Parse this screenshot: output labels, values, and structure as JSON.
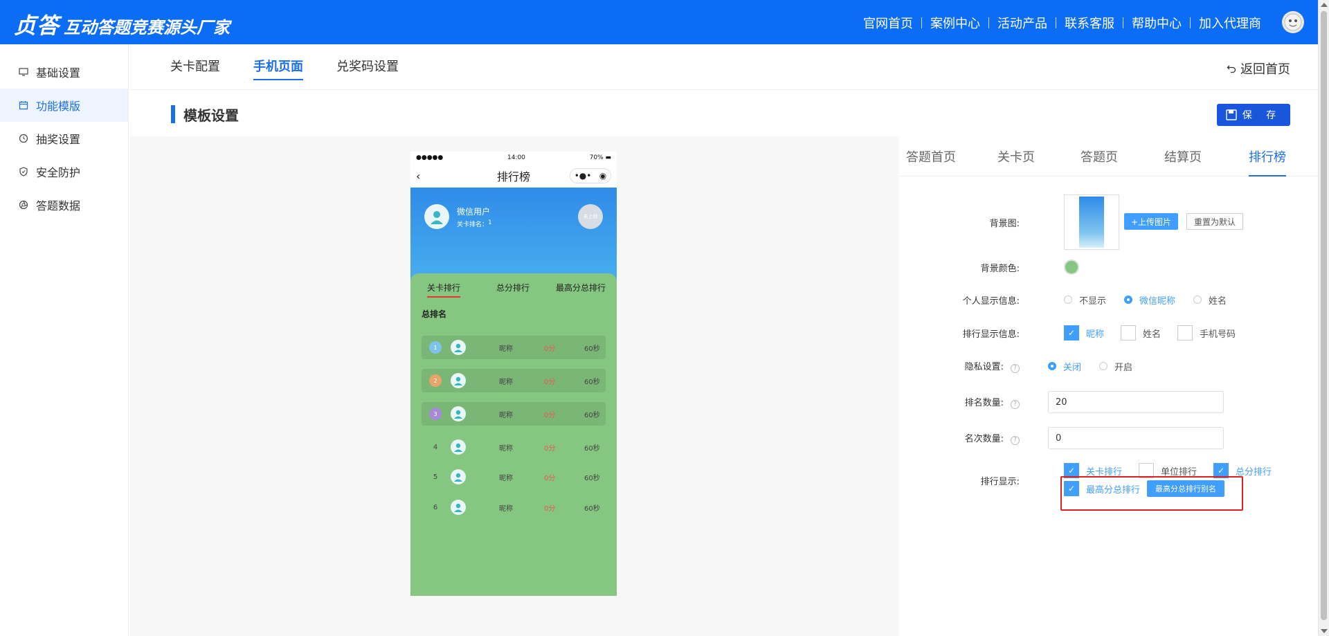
{
  "brand": {
    "logo": "贞答",
    "tagline": "互动答题竞赛源头厂家"
  },
  "topnav": [
    "官网首页",
    "案例中心",
    "活动产品",
    "联系客服",
    "帮助中心",
    "加入代理商"
  ],
  "sidebar": {
    "items": [
      {
        "label": "基础设置",
        "icon": "monitor-icon"
      },
      {
        "label": "功能模版",
        "icon": "calendar-icon",
        "active": true
      },
      {
        "label": "抽奖设置",
        "icon": "clock-icon"
      },
      {
        "label": "安全防护",
        "icon": "shield-icon"
      },
      {
        "label": "答题数据",
        "icon": "aperture-icon"
      }
    ]
  },
  "subtabs": [
    {
      "label": "关卡配置"
    },
    {
      "label": "手机页面",
      "active": true
    },
    {
      "label": "兑奖码设置"
    }
  ],
  "back_home": "返回首页",
  "section_title": "模板设置",
  "save_label": "保 存",
  "phone": {
    "status_signal": "●●●●●",
    "status_time": "14:00",
    "status_battery": "70%",
    "nav_title": "排行榜",
    "capsule_more": "•●•",
    "user_name": "微信用户",
    "user_rank_label": "关卡排名：",
    "user_rank_value": "1",
    "badge_text": "未上榜",
    "rank_tabs": [
      "关卡排行",
      "总分排行",
      "最高分总排行"
    ],
    "total_label": "总排名",
    "rows": [
      {
        "num": "1",
        "nick": "昵称",
        "score": "0分",
        "time": "60秒"
      },
      {
        "num": "2",
        "nick": "昵称",
        "score": "0分",
        "time": "60秒"
      },
      {
        "num": "3",
        "nick": "昵称",
        "score": "0分",
        "time": "60秒"
      },
      {
        "num": "4",
        "nick": "昵称",
        "score": "0分",
        "time": "60秒"
      },
      {
        "num": "5",
        "nick": "昵称",
        "score": "0分",
        "time": "60秒"
      },
      {
        "num": "6",
        "nick": "昵称",
        "score": "0分",
        "time": "60秒"
      }
    ],
    "colors": {
      "hero_top": "#2f8be8",
      "panel_green": "#85c680"
    }
  },
  "settings": {
    "tabs": [
      "答题首页",
      "关卡页",
      "答题页",
      "结算页",
      "排行榜"
    ],
    "active_tab": "排行榜",
    "bg_image_label": "背景图:",
    "upload_label": "+上传图片",
    "reset_label": "重置为默认",
    "bg_color_label": "背景颜色:",
    "bg_color": "#85c680",
    "personal_label": "个人显示信息:",
    "personal_options": [
      "不显示",
      "微信昵称",
      "姓名"
    ],
    "personal_selected": "微信昵称",
    "rank_info_label": "排行显示信息:",
    "rank_info_options": [
      {
        "label": "昵称",
        "checked": true
      },
      {
        "label": "姓名",
        "checked": false
      },
      {
        "label": "手机号码",
        "checked": false
      }
    ],
    "privacy_label": "隐私设置:",
    "privacy_options": [
      "关闭",
      "开启"
    ],
    "privacy_selected": "关闭",
    "rank_count_label": "排名数量:",
    "rank_count_value": "20",
    "place_count_label": "名次数量:",
    "place_count_value": "0",
    "rank_display_label": "排行显示:",
    "rank_display_options": [
      {
        "label": "关卡排行",
        "checked": true
      },
      {
        "label": "单位排行",
        "checked": false
      },
      {
        "label": "总分排行",
        "checked": true
      },
      {
        "label": "最高分总排行",
        "checked": true
      }
    ],
    "alias_button": "最高分总排行别名"
  }
}
